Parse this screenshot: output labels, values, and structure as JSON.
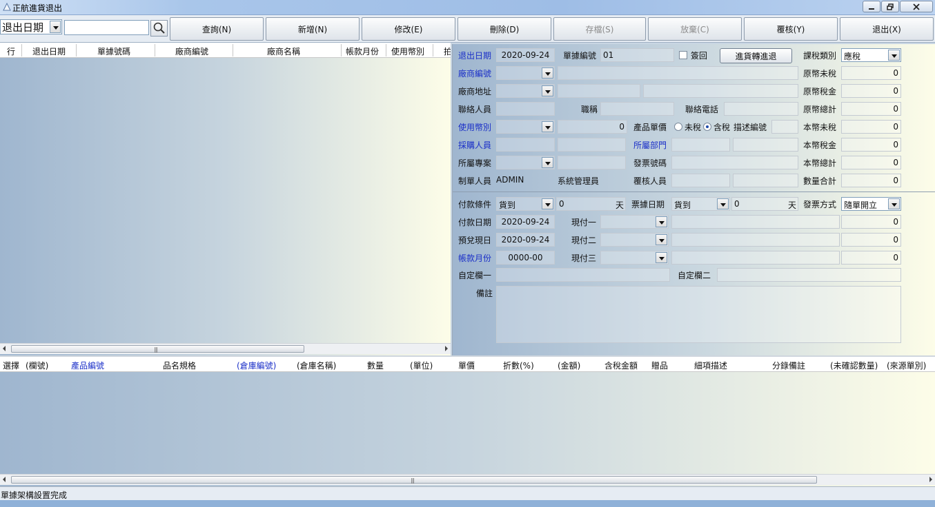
{
  "window": {
    "title": "正航進貨退出"
  },
  "toolbar": {
    "field_select": "退出日期",
    "search_value": "",
    "buttons": [
      {
        "label": "查詢(N)",
        "enabled": true
      },
      {
        "label": "新增(N)",
        "enabled": true
      },
      {
        "label": "修改(E)",
        "enabled": true
      },
      {
        "label": "刪除(D)",
        "enabled": true
      },
      {
        "label": "存檔(S)",
        "enabled": false
      },
      {
        "label": "放棄(C)",
        "enabled": false
      },
      {
        "label": "覆核(Y)",
        "enabled": true
      },
      {
        "label": "退出(X)",
        "enabled": true
      }
    ]
  },
  "list_grid": {
    "columns": [
      "行",
      "退出日期",
      "單據號碼",
      "廠商編號",
      "廠商名稱",
      "帳款月份",
      "使用幣別",
      "拍"
    ]
  },
  "form": {
    "return_date_label": "退出日期",
    "return_date": "2020-09-24",
    "doc_no_label": "單據編號",
    "doc_no": "01",
    "returned_label": "簽回",
    "convert_button": "進貨轉進退",
    "tax_type_label": "課稅類別",
    "tax_type": "應稅",
    "vendor_code_label": "廠商編號",
    "vendor_address_label": "廠商地址",
    "contact_label": "聯絡人員",
    "title_label": "職稱",
    "phone_label": "聯絡電話",
    "currency_label": "使用幣別",
    "currency_rate": "0",
    "unit_price_label": "產品單價",
    "untaxed_label": "未稅",
    "taxed_label": "含稅",
    "desc_no_label": "描述編號",
    "buyer_label": "採購人員",
    "dept_label": "所屬部門",
    "project_label": "所屬專案",
    "invoice_no_label": "發票號碼",
    "maker_label": "制單人員",
    "maker_id": "ADMIN",
    "maker_name": "系統管理員",
    "reviewer_label": "覆核人員",
    "orig_untaxed_label": "原幣未稅",
    "orig_untaxed": "0",
    "orig_tax_label": "原幣稅金",
    "orig_tax": "0",
    "orig_total_label": "原幣總計",
    "orig_total": "0",
    "local_untaxed_label": "本幣未稅",
    "local_untaxed": "0",
    "local_tax_label": "本幣稅金",
    "local_tax": "0",
    "local_total_label": "本幣總計",
    "local_total": "0",
    "qty_total_label": "數量合計",
    "qty_total": "0",
    "pay_terms_label": "付款條件",
    "pay_terms": "貨到",
    "pay_days": "0",
    "day_unit": "天",
    "bill_date_label": "票據日期",
    "bill_terms": "貨到",
    "bill_days": "0",
    "invoice_method_label": "發票方式",
    "invoice_method": "隨單開立",
    "pay_date_label": "付款日期",
    "pay_date": "2020-09-24",
    "expected_date_label": "預兌現日",
    "expected_date": "2020-09-24",
    "account_month_label": "帳款月份",
    "account_month": "0000-00",
    "cash1_label": "現付一",
    "cash1_amount": "0",
    "cash2_label": "現付二",
    "cash2_amount": "0",
    "cash3_label": "現付三",
    "cash3_amount": "0",
    "custom1_label": "自定欄一",
    "custom2_label": "自定欄二",
    "remark_label": "備註"
  },
  "detail_grid": {
    "columns": [
      {
        "label": "選擇",
        "blue": false
      },
      {
        "label": "(欄號)",
        "blue": false
      },
      {
        "label": "產品編號",
        "blue": true
      },
      {
        "label": "品名規格",
        "blue": false
      },
      {
        "label": "(倉庫編號)",
        "blue": true
      },
      {
        "label": "(倉庫名稱)",
        "blue": false
      },
      {
        "label": "數量",
        "blue": false
      },
      {
        "label": "(單位)",
        "blue": false
      },
      {
        "label": "單價",
        "blue": false
      },
      {
        "label": "折數(%)",
        "blue": false
      },
      {
        "label": "(金額)",
        "blue": false
      },
      {
        "label": "含稅金額",
        "blue": false
      },
      {
        "label": "贈品",
        "blue": false
      },
      {
        "label": "細項描述",
        "blue": false
      },
      {
        "label": "分錄備註",
        "blue": false
      },
      {
        "label": "(未確認數量)",
        "blue": false
      },
      {
        "label": "(來源單別)",
        "blue": false
      }
    ]
  },
  "status": {
    "text": "單據架構設置完成"
  }
}
